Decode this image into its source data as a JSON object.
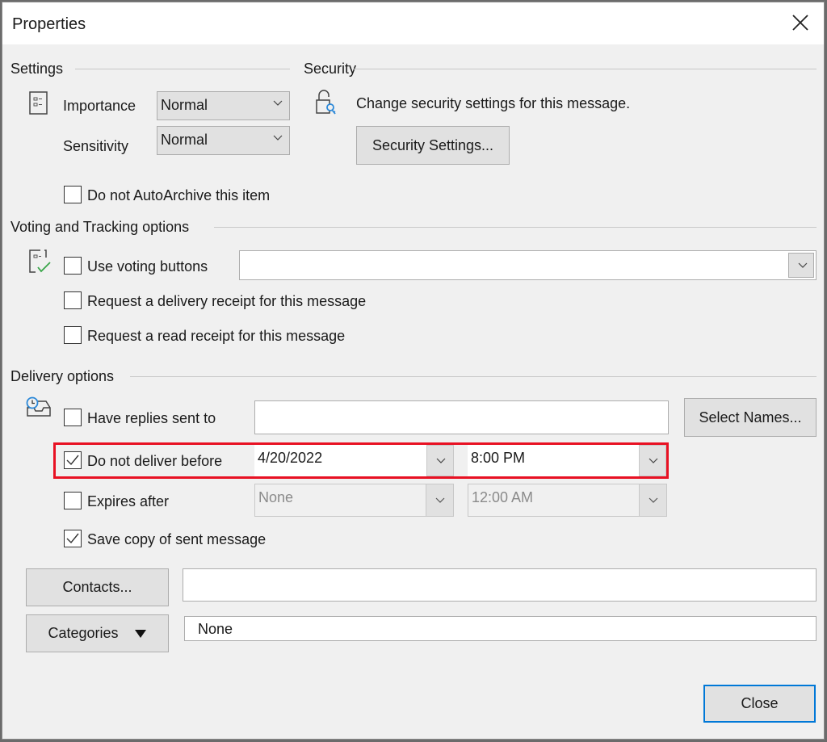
{
  "window": {
    "title": "Properties",
    "close_icon": "close-icon"
  },
  "settings": {
    "label": "Settings",
    "importance_label": "Importance",
    "importance_value": "Normal",
    "sensitivity_label": "Sensitivity",
    "sensitivity_value": "Normal",
    "autoarchive_label": "Do not AutoArchive this item",
    "autoarchive_checked": false
  },
  "security": {
    "label": "Security",
    "description": "Change security settings for this message.",
    "button_label": "Security Settings..."
  },
  "voting": {
    "label": "Voting and Tracking options",
    "use_voting_label": "Use voting buttons",
    "use_voting_checked": false,
    "voting_value": "",
    "delivery_receipt_label": "Request a delivery receipt for this message",
    "delivery_receipt_checked": false,
    "read_receipt_label": "Request a read receipt for this message",
    "read_receipt_checked": false
  },
  "delivery": {
    "label": "Delivery options",
    "replies_label": "Have replies sent to",
    "replies_checked": false,
    "replies_value": "",
    "select_names_label": "Select Names...",
    "defer_label": "Do not deliver before",
    "defer_checked": true,
    "defer_date": "4/20/2022",
    "defer_time": "8:00 PM",
    "expires_label": "Expires after",
    "expires_checked": false,
    "expires_date": "None",
    "expires_time": "12:00 AM",
    "save_copy_label": "Save copy of sent message",
    "save_copy_checked": true
  },
  "footer": {
    "contacts_label": "Contacts...",
    "contacts_value": "",
    "categories_label": "Categories",
    "categories_value": "None",
    "close_label": "Close"
  },
  "colors": {
    "highlight": "#e81123",
    "focus": "#0078d7",
    "icon_blue": "#2b88d8",
    "check_green": "#3aa64a"
  }
}
